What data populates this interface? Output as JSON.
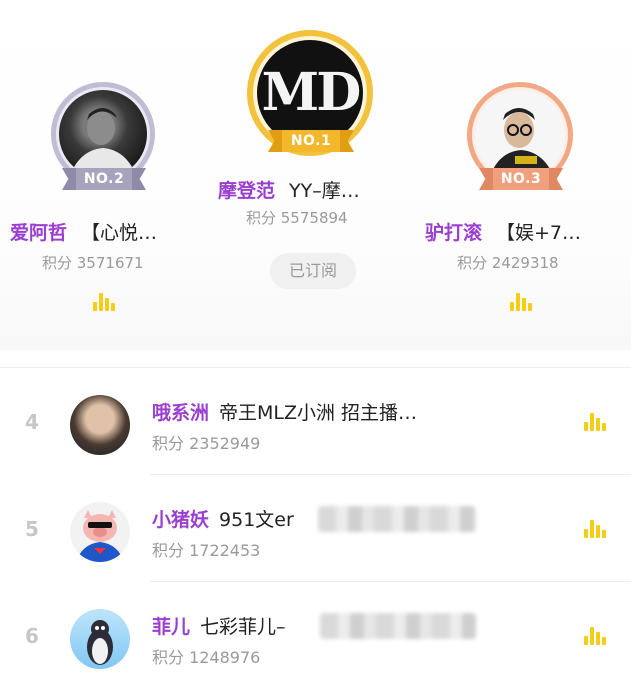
{
  "podium": {
    "second": {
      "badge": "NO.2",
      "name": "爱阿哲",
      "subtitle": "【心悦…",
      "score": "积分 3571671"
    },
    "first": {
      "badge": "NO.1",
      "name": "摩登范",
      "subtitle": "YY–摩…",
      "score": "积分 5575894",
      "logo_text": "MD"
    },
    "third": {
      "badge": "NO.3",
      "name": "驴打滚",
      "subtitle": "【娱+7…",
      "score": "积分 2429318"
    },
    "subscribe_label": "已订阅"
  },
  "list": [
    {
      "rank": "4",
      "name": "哦系洲",
      "subtitle": "帝王MLZ小洲 招主播…",
      "score": "积分 2352949"
    },
    {
      "rank": "5",
      "name": "小猪妖",
      "subtitle": "951文er",
      "score": "积分 1722453"
    },
    {
      "rank": "6",
      "name": "菲儿",
      "subtitle": "七彩菲儿–",
      "score": "积分 1248976"
    }
  ],
  "colors": {
    "name": "#9b3fd1",
    "gold": "#f3b72c",
    "silver": "#a7a3bd",
    "bronze": "#f1a07e",
    "equalizer": "#f5cd14"
  },
  "icons": [
    "crown-icon",
    "equalizer-icon"
  ]
}
